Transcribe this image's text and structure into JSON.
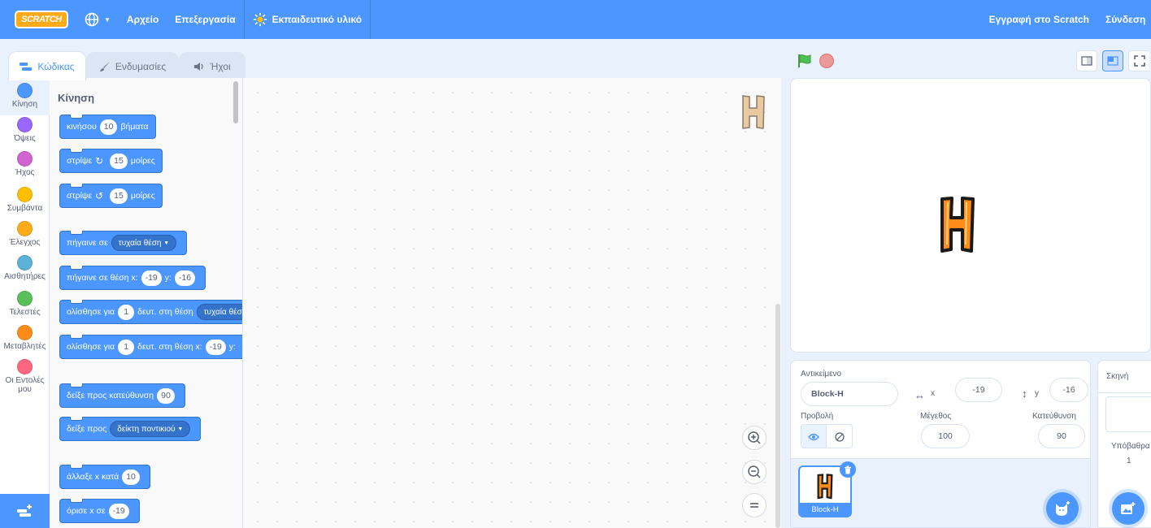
{
  "menubar": {
    "logo": "SCRATCH",
    "file": "Αρχείο",
    "edit": "Επεξεργασία",
    "tutorials": "Εκπαιδευτικό υλικό",
    "join": "Εγγραφή στο Scratch",
    "signin": "Σύνδεση"
  },
  "tabs": {
    "code": "Κώδικας",
    "costumes": "Ενδυμασίες",
    "sounds": "Ήχοι"
  },
  "categories": [
    {
      "label": "Κίνηση",
      "color": "#4c97ff"
    },
    {
      "label": "Όψεις",
      "color": "#9966ff"
    },
    {
      "label": "Ήχος",
      "color": "#cf63cf"
    },
    {
      "label": "Συμβάντα",
      "color": "#ffbf00"
    },
    {
      "label": "Έλεγχος",
      "color": "#ffab19"
    },
    {
      "label": "Αισθητήρες",
      "color": "#5cb1d6"
    },
    {
      "label": "Τελεστές",
      "color": "#59c059"
    },
    {
      "label": "Μεταβλητές",
      "color": "#ff8c1a"
    },
    {
      "label": "Οι Εντολές μου",
      "color": "#ff6680"
    }
  ],
  "palette": {
    "title": "Κίνηση",
    "move": {
      "a": "κινήσου",
      "n": "10",
      "b": "βήματα"
    },
    "turn_right": {
      "a": "στρίψε",
      "n": "15",
      "b": "μοίρες"
    },
    "turn_left": {
      "a": "στρίψε",
      "n": "15",
      "b": "μοίρες"
    },
    "goto": {
      "a": "πήγαινε σε",
      "d": "τυχαία θέση"
    },
    "goto_xy": {
      "a": "πήγαινε σε θέση x:",
      "x": "-19",
      "b": "y:",
      "y": "-16"
    },
    "glide": {
      "a": "ολίσθησε για",
      "n": "1",
      "b": "δευτ. στη θέση",
      "d": "τυχαία θέση"
    },
    "glide_xy": {
      "a": "ολίσθησε για",
      "n": "1",
      "b": "δευτ. στη θέση x:",
      "x": "-19",
      "c": "y:"
    },
    "point_dir": {
      "a": "δείξε προς κατεύθυνση",
      "n": "90"
    },
    "point_towards": {
      "a": "δείξε προς",
      "d": "δείκτη ποντικιού"
    },
    "change_x": {
      "a": "άλλαξε x κατά",
      "n": "10"
    },
    "set_x": {
      "a": "όρισε x σε",
      "n": "-19"
    }
  },
  "sprite_info": {
    "sprite_label": "Αντικείμενο",
    "sprite_name": "Block-H",
    "x_label": "x",
    "x": "-19",
    "y_label": "y",
    "y": "-16",
    "show_label": "Προβολή",
    "size_label": "Μέγεθος",
    "size": "100",
    "direction_label": "Κατεύθυνση",
    "direction": "90"
  },
  "sprites": [
    {
      "name": "Block-H",
      "glyph": "H"
    }
  ],
  "stage_pane": {
    "title": "Σκηνή",
    "backdrops_label": "Υπόβαθρα",
    "backdrops_count": "1"
  },
  "colors": {
    "accent": "#4c97ff",
    "motion": "#4c97ff",
    "sprite_orange": "#ff8c1a"
  }
}
